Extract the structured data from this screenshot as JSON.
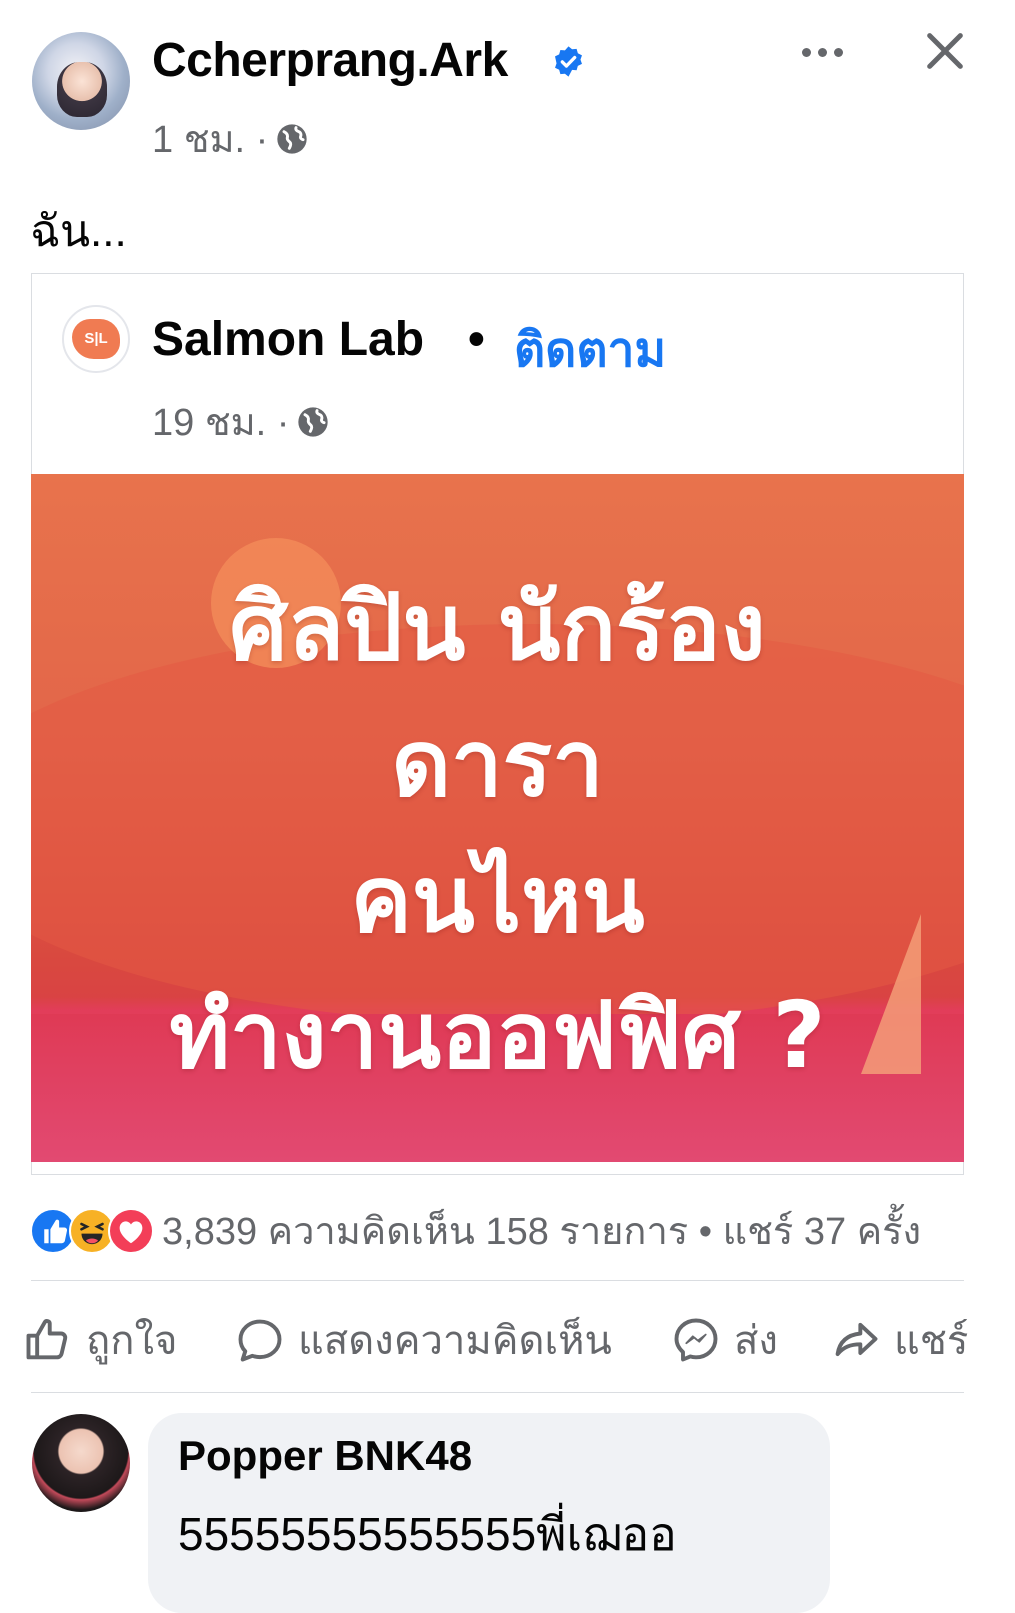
{
  "post": {
    "author": "Ccherprang.Ark",
    "time": "1 ชม. ·",
    "text": "ฉัน..."
  },
  "shared": {
    "page_name": "Salmon Lab",
    "separator": "•",
    "follow_label": "ติดตาม",
    "time": "19 ชม. ·",
    "logo_text": "S|L",
    "image_lines": [
      "ศิลปิน นักร้อง",
      "ดารา",
      "คนไหน",
      "ทำงานออฟฟิศ ?"
    ]
  },
  "summary": {
    "text": "3,839 ความคิดเห็น 158 รายการ • แชร์ 37 ครั้ง",
    "reactions": [
      "like-icon",
      "haha-icon",
      "love-icon"
    ]
  },
  "actions": {
    "like": "ถูกใจ",
    "comment": "แสดงความคิดเห็น",
    "send": "ส่ง",
    "share": "แชร์"
  },
  "comment": {
    "author": "Popper BNK48",
    "text": "55555555555555พี่เฌออ"
  },
  "colors": {
    "link_blue": "#1877f2",
    "muted_text": "#65676b",
    "bubble_bg": "#f0f2f5",
    "image_orange": "#e26549",
    "image_pink": "#e24a72"
  }
}
